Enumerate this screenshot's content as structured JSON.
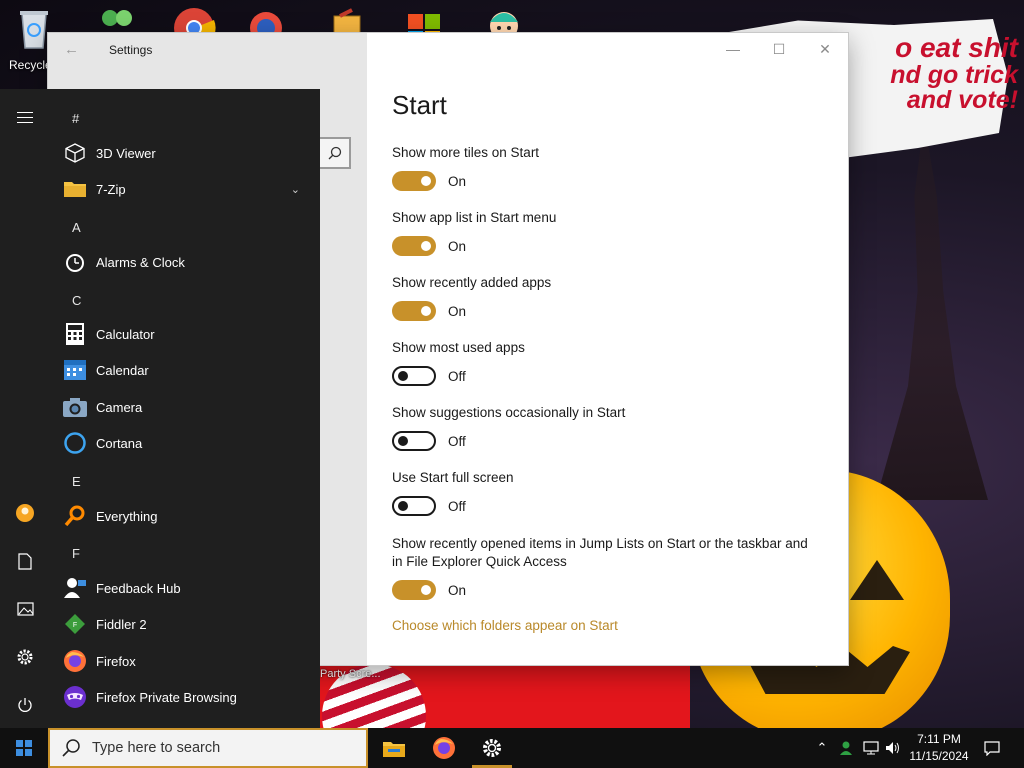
{
  "desktop": {
    "recycle_bin_label": "Recycle",
    "wallpaper_text_line1": "o eat shit",
    "wallpaper_text_line2": "nd go trick",
    "wallpaper_text_line3": "and vote!",
    "wallpaper_caption": "Party Scre..."
  },
  "start_menu": {
    "sections": [
      {
        "letter": "#",
        "apps": [
          {
            "name": "3D Viewer",
            "icon": "cube-icon"
          },
          {
            "name": "7-Zip",
            "icon": "folder-icon",
            "expandable": true
          }
        ]
      },
      {
        "letter": "A",
        "apps": [
          {
            "name": "Alarms & Clock",
            "icon": "alarm-clock-icon"
          }
        ]
      },
      {
        "letter": "C",
        "apps": [
          {
            "name": "Calculator",
            "icon": "calculator-icon"
          },
          {
            "name": "Calendar",
            "icon": "calendar-icon"
          },
          {
            "name": "Camera",
            "icon": "camera-icon"
          },
          {
            "name": "Cortana",
            "icon": "cortana-icon"
          }
        ]
      },
      {
        "letter": "E",
        "apps": [
          {
            "name": "Everything",
            "icon": "magnifier-icon"
          }
        ]
      },
      {
        "letter": "F",
        "apps": [
          {
            "name": "Feedback Hub",
            "icon": "feedback-icon"
          },
          {
            "name": "Fiddler 2",
            "icon": "fiddler-icon"
          },
          {
            "name": "Firefox",
            "icon": "firefox-icon"
          },
          {
            "name": "Firefox Private Browsing",
            "icon": "firefox-private-icon"
          }
        ]
      }
    ],
    "rail": [
      "hamburger-icon",
      "user-avatar-icon",
      "documents-icon",
      "pictures-icon",
      "settings-gear-icon",
      "power-icon"
    ]
  },
  "settings": {
    "window_title": "Settings",
    "page_title": "Start",
    "options": [
      {
        "label": "Show more tiles on Start",
        "state": "On",
        "on": true
      },
      {
        "label": "Show app list in Start menu",
        "state": "On",
        "on": true
      },
      {
        "label": "Show recently added apps",
        "state": "On",
        "on": true
      },
      {
        "label": "Show most used apps",
        "state": "Off",
        "on": false
      },
      {
        "label": "Show suggestions occasionally in Start",
        "state": "Off",
        "on": false
      },
      {
        "label": "Use Start full screen",
        "state": "Off",
        "on": false
      },
      {
        "label": "Show recently opened items in Jump Lists on Start or the taskbar and in File Explorer Quick Access",
        "state": "On",
        "on": true
      }
    ],
    "folders_link": "Choose which folders appear on Start",
    "accent_color": "#c8912a"
  },
  "taskbar": {
    "search_placeholder": "Type here to search",
    "clock_time": "7:11 PM",
    "clock_date": "11/15/2024",
    "pinned": [
      "file-explorer-icon",
      "firefox-icon",
      "settings-icon"
    ]
  }
}
